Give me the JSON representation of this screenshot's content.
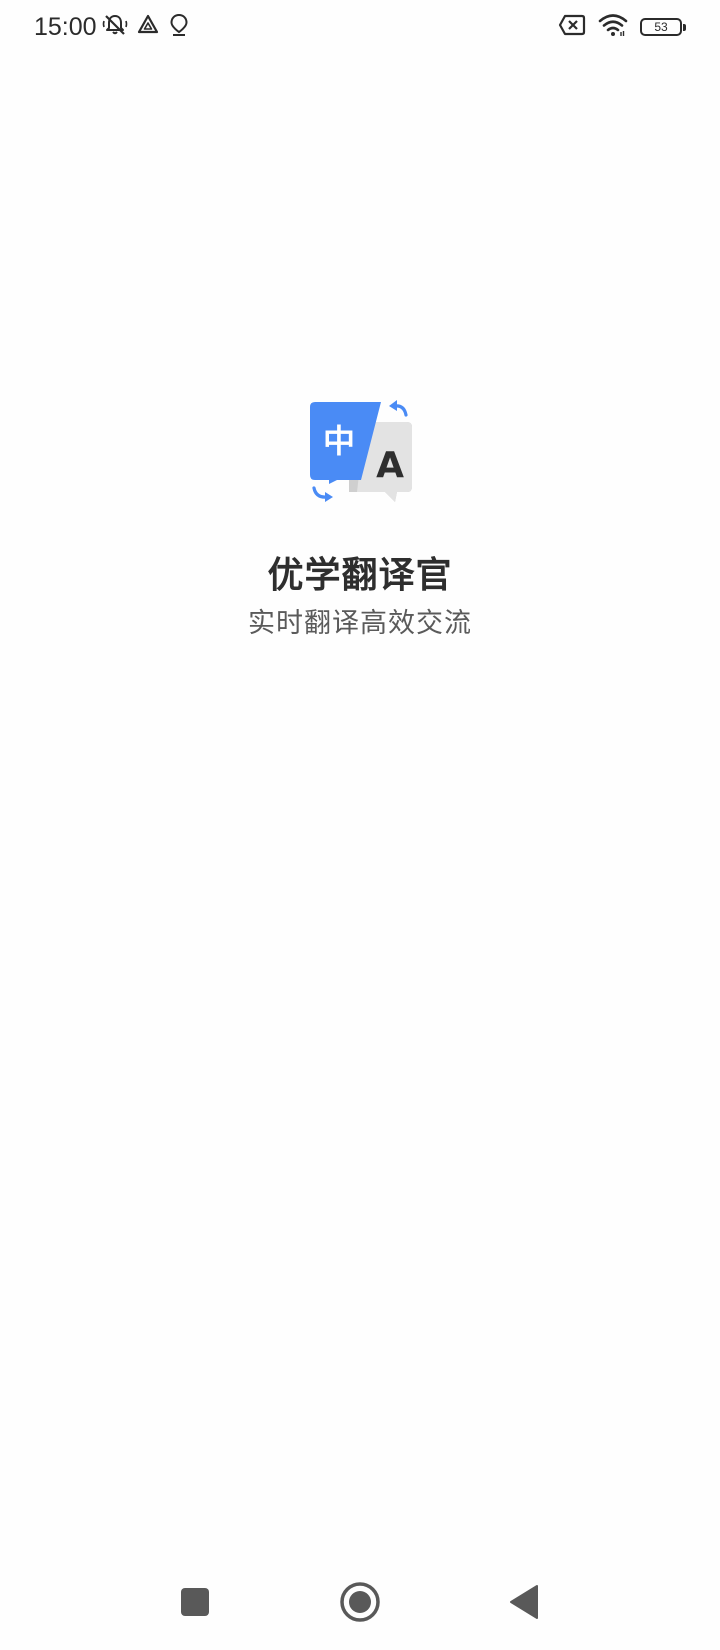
{
  "status_bar": {
    "time": "15:00",
    "battery_level": "53",
    "icons_left": [
      "mute-notification-icon",
      "drive-icon",
      "location-icon"
    ],
    "icons_right": [
      "no-sim-icon",
      "wifi-icon",
      "battery-icon"
    ]
  },
  "splash": {
    "app_name": "优学翻译官",
    "slogan": "实时翻译高效交流",
    "logo": {
      "icon": "translate-logo-icon",
      "source_glyph": "中",
      "target_glyph": "A"
    }
  },
  "nav_bar": {
    "buttons": [
      "recents-button",
      "home-button",
      "back-button"
    ]
  },
  "colors": {
    "brand_blue": "#4A8BF5",
    "bubble_gray": "#E3E3E3",
    "bubble_gray_shadow": "#CFCFCF",
    "text_primary": "#2E2E2E",
    "text_secondary": "#5A5A5A",
    "nav_icon": "#595959"
  }
}
